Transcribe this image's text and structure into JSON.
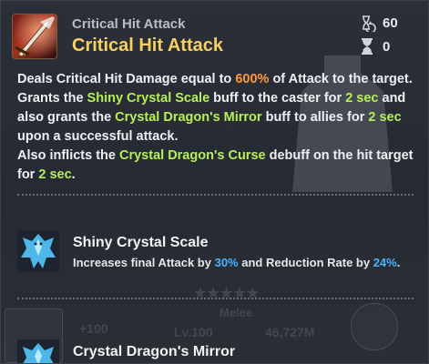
{
  "skill": {
    "subtitle": "Critical Hit Attack",
    "title": "Critical Hit Attack",
    "cooldown": "60",
    "cost": "0"
  },
  "description": {
    "line1_a": "Deals Critical Hit Damage equal to ",
    "line1_b": "600%",
    "line1_c": " of Attack to the target.",
    "line2_a": "Grants the ",
    "line2_b": "Shiny Crystal Scale",
    "line2_c": " buff to the caster for ",
    "line2_d": "2 sec",
    "line2_e": " and",
    "line3_a": "also grants the ",
    "line3_b": "Crystal Dragon's Mirror",
    "line3_c": " buff to allies for ",
    "line3_d": "2 sec",
    "line4": "upon a successful attack.",
    "line5_a": "Also inflicts the ",
    "line5_b": "Crystal Dragon's Curse",
    "line5_c": " debuff on the hit target",
    "line6_a": "for ",
    "line6_b": "2 sec",
    "line6_c": "."
  },
  "buffs": [
    {
      "name": "Shiny Crystal Scale",
      "desc_a": "Increases final Attack by ",
      "desc_b": "30%",
      "desc_c": " and Reduction Rate by ",
      "desc_d": "24%",
      "desc_e": "."
    },
    {
      "name": "Crystal Dragon's Mirror"
    }
  ],
  "background": {
    "plus": "+100",
    "level": "Lv.100",
    "power": "46,727M",
    "melee": "Melee"
  },
  "colors": {
    "title": "#f6d060",
    "value_orange": "#ff9a3c",
    "value_green": "#b7ef58",
    "value_blue": "#4ab3ff"
  },
  "icons": {
    "skill": "crossed-swords-icon",
    "cooldown": "hourglass-arrow-icon",
    "cost": "hourglass-icon",
    "buff1": "crystal-dragon-icon",
    "buff2": "crystal-dragon-icon"
  }
}
